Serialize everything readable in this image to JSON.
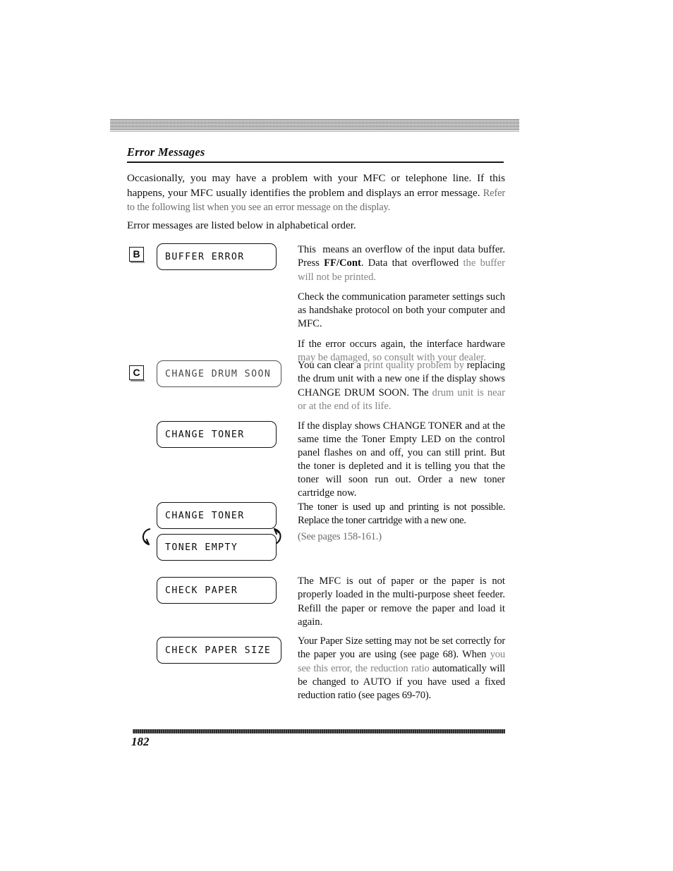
{
  "document": {
    "section_title": "Error Messages",
    "page_number": "182"
  },
  "intro": {
    "paragraph_1_line_1": "Occasionally, you may have a problem with your MFC or telephone line. If this",
    "paragraph_1_line_2": "happens, your MFC usually identifies the problem and displays an error message.",
    "paragraph_1_line_3": "Refer to the following list when you see an error message on the display.",
    "paragraph_2": "Error messages are listed below in alphabetical order."
  },
  "entries": [
    {
      "badge": "B",
      "lcd": "BUFFER ERROR",
      "paragraphs": [
        "This  means an overflow of the input data buffer. Press FF/Cont. Data that overflowed the buffer will not be printed.",
        "Check the communication parameter settings such as handshake protocol on both your computer and MFC.",
        "If the error occurs again, the interface hardware may be damaged, so consult with your dealer."
      ],
      "bold_term": "FF/Cont"
    },
    {
      "badge": "C",
      "lcd": "CHANGE DRUM SOON",
      "paragraphs": [
        "You can clear a print quality problem by replacing the drum unit with a new one if the display shows CHANGE DRUM SOON. The drum unit is near or at the end of its life."
      ]
    },
    {
      "badge": "",
      "lcd": "CHANGE TONER",
      "paragraphs": [
        "If the display shows CHANGE TONER and at the same time the Toner Empty LED on the control panel flashes on and off, you can still print. But the toner is depleted and it is telling you that the toner will soon run out. Order a new toner cartridge now."
      ]
    },
    {
      "badge": "",
      "lcd": "CHANGE TONER",
      "lcd_2": "TONER EMPTY",
      "paragraphs": [
        "The toner is used up and printing is not possible. Replace the toner cartridge with a new one.",
        "(See pages 158-161.)"
      ]
    },
    {
      "badge": "",
      "lcd": "CHECK PAPER",
      "paragraphs": [
        "The MFC is out of paper or the paper is not properly loaded in the multi-purpose sheet feeder. Refill the paper or remove the paper and load it again."
      ]
    },
    {
      "badge": "",
      "lcd": "CHECK PAPER SIZE",
      "paragraphs": [
        "Your Paper Size setting may not be set correctly for the paper you are using (see page 68). When you see this error, the reduction ratio automatically will be changed to AUTO if you have used a fixed reduction ratio (see pages 69-70)."
      ]
    }
  ],
  "icons": {
    "cycle_arrow_left": "curved-arrow-left",
    "cycle_arrow_right": "curved-arrow-right"
  },
  "colors": {
    "ink": "#111111",
    "band": "#b9b9b9",
    "rule": "#171717"
  }
}
